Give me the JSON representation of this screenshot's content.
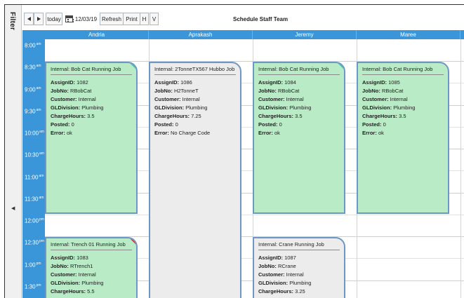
{
  "filter": {
    "label": "Filter"
  },
  "toolbar": {
    "prev_icon": "triangle-left",
    "next_icon": "triangle-right",
    "today_label": "today",
    "date_icon": "calendar-icon",
    "date_value": "12/03/19",
    "refresh_label": "Refresh",
    "print_label": "Print",
    "h_label": "H",
    "v_label": "V",
    "title": "Schedule Staff Team"
  },
  "columns": [
    "Andria",
    "Aprakash",
    "Jeremy",
    "Maree"
  ],
  "times": [
    {
      "time": "8:00",
      "ampm": "am"
    },
    {
      "time": "8:30",
      "ampm": "am"
    },
    {
      "time": "9:00",
      "ampm": "am"
    },
    {
      "time": "9:30",
      "ampm": "am"
    },
    {
      "time": "10:00",
      "ampm": "am"
    },
    {
      "time": "10:30",
      "ampm": "am"
    },
    {
      "time": "11:00",
      "ampm": "am"
    },
    {
      "time": "11:30",
      "ampm": "am"
    },
    {
      "time": "12:00",
      "ampm": "pm"
    },
    {
      "time": "12:30",
      "ampm": "pm"
    },
    {
      "time": "1:00",
      "ampm": "pm"
    },
    {
      "time": "1:30",
      "ampm": "pm"
    }
  ],
  "field_labels": {
    "assign_id": "AssignID:",
    "job_no": "JobNo:",
    "customer": "Customer:",
    "gl_division": "GLDivision:",
    "charge_hours": "ChargeHours:",
    "posted": "Posted:",
    "error": "Error:"
  },
  "events": [
    {
      "title": "Internal: Bob Cat Running Job",
      "assign_id": "1082",
      "job_no": "RBobCat",
      "customer": "Internal",
      "gl_division": "Plumbing",
      "charge_hours": "3.5",
      "posted": "0",
      "error": "ok",
      "color": "#b9ebc6",
      "corner_color": "#3cc8b3"
    },
    {
      "title": "Internal: 2TonneTX567 Hubbo Job",
      "assign_id": "1086",
      "job_no": "H2TonneT",
      "customer": "Internal",
      "gl_division": "Plumbing",
      "charge_hours": "7.25",
      "posted": "0",
      "error": "No Charge Code",
      "color": "#ececec",
      "corner_color": ""
    },
    {
      "title": "Internal: Bob Cat Running Job",
      "assign_id": "1084",
      "job_no": "RBobCat",
      "customer": "Internal",
      "gl_division": "Plumbing",
      "charge_hours": "3.5",
      "posted": "0",
      "error": "ok",
      "color": "#b9ebc6",
      "corner_color": "#3cc8b3"
    },
    {
      "title": "Internal: Bob Cat Running Job",
      "assign_id": "1085",
      "job_no": "RBobCat",
      "customer": "Internal",
      "gl_division": "Plumbing",
      "charge_hours": "3.5",
      "posted": "0",
      "error": "ok",
      "color": "#b9ebc6",
      "corner_color": ""
    },
    {
      "title": "Internal: Trench 01 Running Job",
      "assign_id": "1083",
      "job_no": "RTrench1",
      "customer": "Internal",
      "gl_division": "Plumbing",
      "charge_hours": "5.5",
      "color": "#b9ebc6",
      "corner_color": "#e02020"
    },
    {
      "title": "Internal: Crane Running Job",
      "assign_id": "1087",
      "job_no": "RCrane",
      "customer": "Internal",
      "gl_division": "Plumbing",
      "charge_hours": "3.25",
      "color": "#ececec",
      "corner_color": ""
    }
  ],
  "colors": {
    "header_blue": "#3b95d9",
    "event_border": "#6d97c9",
    "event_ok": "#b9ebc6",
    "event_pending": "#ececec"
  }
}
